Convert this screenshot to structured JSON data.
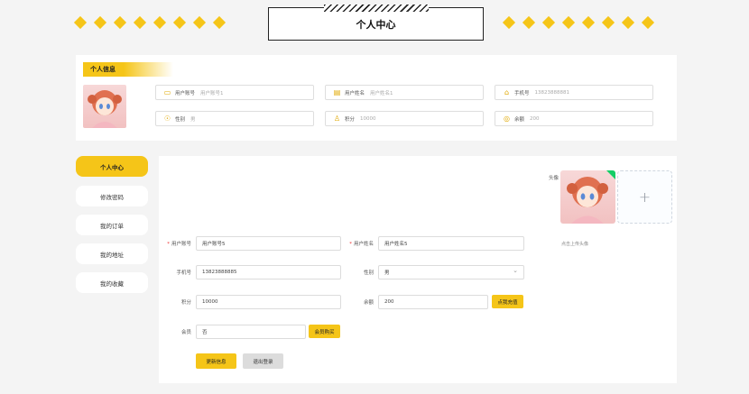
{
  "header": {
    "title": "个人中心"
  },
  "info": {
    "tag": "个人信息",
    "fields": [
      {
        "icon": "id-card-icon",
        "glyph": "▭",
        "label": "用户账号",
        "value": "用户账号1"
      },
      {
        "icon": "document-icon",
        "glyph": "▤",
        "label": "用户姓名",
        "value": "用户姓名1"
      },
      {
        "icon": "home-icon",
        "glyph": "⌂",
        "label": "手机号",
        "value": "13823888881"
      },
      {
        "icon": "users-icon",
        "glyph": "☉",
        "label": "性别",
        "value": "男"
      },
      {
        "icon": "user-icon",
        "glyph": "♙",
        "label": "积分",
        "value": "10000"
      },
      {
        "icon": "coin-icon",
        "glyph": "◎",
        "label": "余额",
        "value": "200"
      }
    ]
  },
  "sidebar": {
    "items": [
      {
        "label": "个人中心",
        "active": true
      },
      {
        "label": "修改密码",
        "active": false
      },
      {
        "label": "我的订单",
        "active": false
      },
      {
        "label": "我的地址",
        "active": false
      },
      {
        "label": "我的收藏",
        "active": false
      }
    ]
  },
  "form": {
    "avatar_label": "头像",
    "upload_hint": "点击上传头像",
    "account_label": "用户账号",
    "account_value": "用户账号5",
    "name_label": "用户姓名",
    "name_value": "用户姓名5",
    "phone_label": "手机号",
    "phone_value": "13823888885",
    "gender_label": "性别",
    "gender_value": "男",
    "points_label": "积分",
    "points_value": "10000",
    "balance_label": "余额",
    "balance_value": "200",
    "recharge_button": "点我充值",
    "member_label": "会员",
    "member_value": "否",
    "member_buy_button": "会员购买",
    "update_button": "更新信息",
    "logout_button": "退出登录"
  },
  "colors": {
    "accent": "#f5c518",
    "background": "#f4f4f4"
  }
}
